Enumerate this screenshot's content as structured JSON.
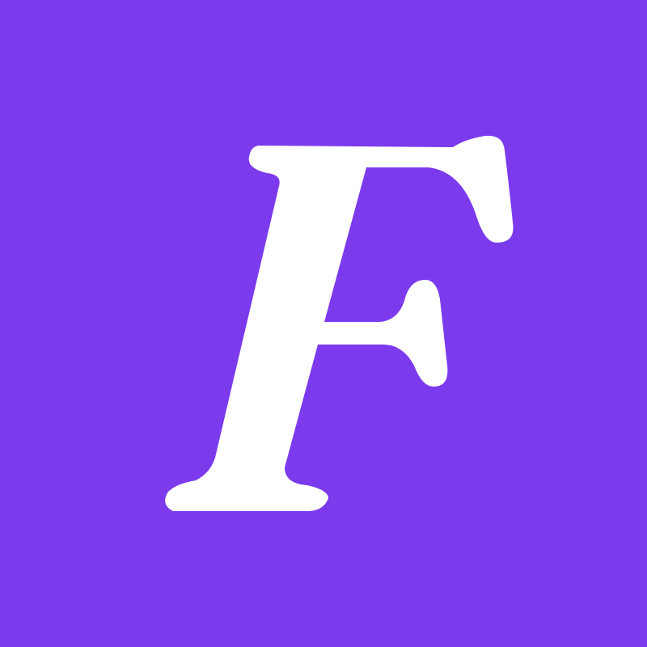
{
  "logo": {
    "letter": "F",
    "background_color": "#7c3aed",
    "glyph_color": "#ffffff",
    "icon": "letter-f-logo-icon"
  }
}
